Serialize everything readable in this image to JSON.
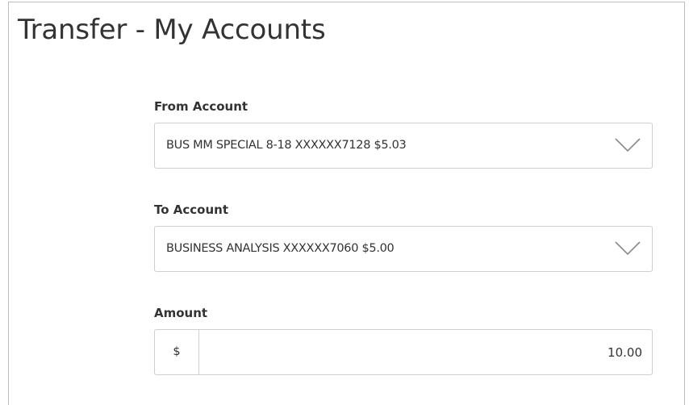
{
  "page": {
    "title": "Transfer - My Accounts"
  },
  "from_account": {
    "label": "From Account",
    "selected": "BUS MM SPECIAL 8-18 XXXXXX7128 $5.03",
    "icon": "chevron-down-icon"
  },
  "to_account": {
    "label": "To Account",
    "selected": "BUSINESS ANALYSIS XXXXXX7060 $5.00",
    "icon": "chevron-down-icon"
  },
  "amount": {
    "label": "Amount",
    "currency_symbol": "$",
    "value": "10.00"
  },
  "colors": {
    "text": "#333333",
    "border": "#cfcfcf",
    "panel_border": "#bdbdbd",
    "chevron": "#8a8a8a"
  }
}
